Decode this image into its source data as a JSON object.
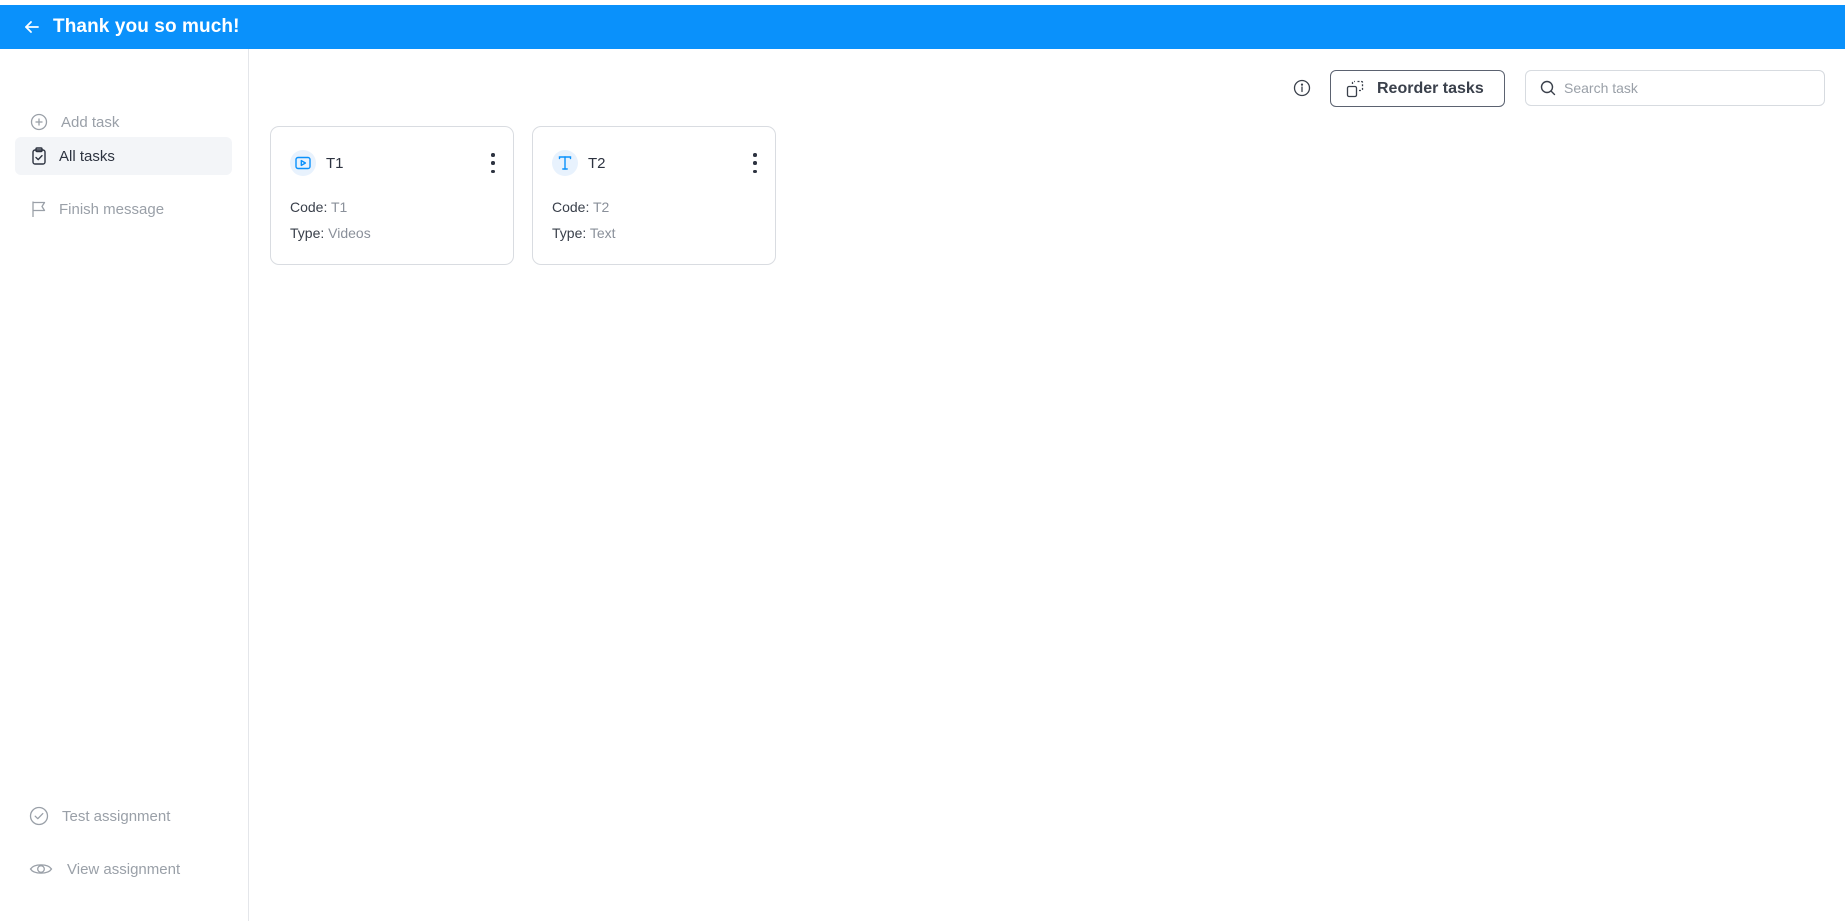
{
  "header": {
    "title": "Thank you so much!"
  },
  "sidebar": {
    "top_items": [
      {
        "label": "Add task",
        "icon": "plus-circle-icon"
      },
      {
        "label": "All tasks",
        "icon": "clipboard-check-icon",
        "active": true
      },
      {
        "label": "Finish message",
        "icon": "flag-icon"
      }
    ],
    "bottom_items": [
      {
        "label": "Test assignment",
        "icon": "check-circle-icon"
      },
      {
        "label": "View assignment",
        "icon": "eye-icon"
      }
    ]
  },
  "toolbar": {
    "reorder_label": "Reorder tasks",
    "search_placeholder": "Search task"
  },
  "tasks": [
    {
      "name": "T1",
      "code_label": "Code:",
      "code": "T1",
      "type_label": "Type:",
      "type": "Videos",
      "icon": "video-icon"
    },
    {
      "name": "T2",
      "code_label": "Code:",
      "code": "T2",
      "type_label": "Type:",
      "type": "Text",
      "icon": "text-icon"
    }
  ],
  "colors": {
    "accent": "#0a91fb",
    "active_bg": "#f3f5f8"
  }
}
